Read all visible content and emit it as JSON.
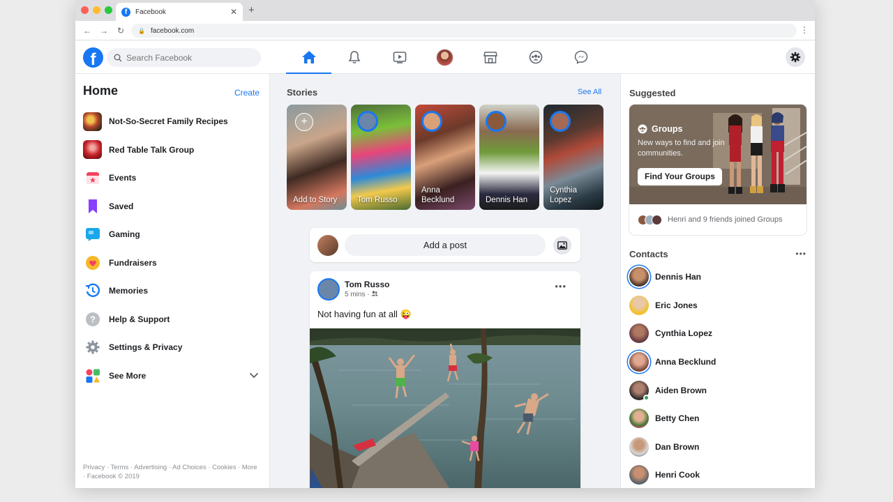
{
  "browser": {
    "tab_title": "Facebook",
    "tab_favicon": "f",
    "url": "facebook.com"
  },
  "header": {
    "logo": "f",
    "search_placeholder": "Search Facebook",
    "nav": [
      "home-icon",
      "bell-icon",
      "watch-icon",
      "profile-avatar",
      "marketplace-icon",
      "groups-icon",
      "messenger-icon"
    ],
    "active_nav": "home-icon",
    "accent": "#1877f2"
  },
  "left": {
    "title": "Home",
    "create": "Create",
    "items": [
      {
        "label": "Not-So-Secret Family Recipes",
        "icon": "group-photo-recipes"
      },
      {
        "label": "Red Table Talk Group",
        "icon": "group-photo-red-table"
      },
      {
        "label": "Events",
        "icon": "calendar-icon"
      },
      {
        "label": "Saved",
        "icon": "bookmark-icon"
      },
      {
        "label": "Gaming",
        "icon": "gaming-icon"
      },
      {
        "label": "Fundraisers",
        "icon": "heart-icon"
      },
      {
        "label": "Memories",
        "icon": "clock-icon"
      },
      {
        "label": "Help & Support",
        "icon": "question-icon"
      },
      {
        "label": "Settings & Privacy",
        "icon": "gear-icon"
      },
      {
        "label": "See More",
        "icon": "grid-icon"
      }
    ],
    "footer": "Privacy · Terms · Advertising · Ad Choices · Cookies · More · Facebook © 2019"
  },
  "stories": {
    "title": "Stories",
    "see_all": "See All",
    "items": [
      {
        "name": "Add to Story"
      },
      {
        "name": "Tom Russo"
      },
      {
        "name": "Anna Becklund"
      },
      {
        "name": "Dennis Han"
      },
      {
        "name": "Cynthia Lopez"
      }
    ]
  },
  "composer": {
    "placeholder": "Add a post"
  },
  "post": {
    "author": "Tom Russo",
    "time": "5 mins",
    "text": "Not having fun at all",
    "emoji": "😜"
  },
  "suggested": {
    "title": "Suggested",
    "card_title": "Groups",
    "card_desc": "New ways to find and join communities.",
    "button": "Find Your Groups",
    "footer": "Henri and 9 friends joined Groups"
  },
  "contacts": {
    "title": "Contacts",
    "items": [
      {
        "name": "Dennis Han",
        "story": true,
        "online": false
      },
      {
        "name": "Eric Jones",
        "story": false,
        "online": false
      },
      {
        "name": "Cynthia Lopez",
        "story": false,
        "online": false
      },
      {
        "name": "Anna Becklund",
        "story": true,
        "online": false
      },
      {
        "name": "Aiden Brown",
        "story": false,
        "online": true
      },
      {
        "name": "Betty Chen",
        "story": false,
        "online": false
      },
      {
        "name": "Dan Brown",
        "story": false,
        "online": false
      },
      {
        "name": "Henri Cook",
        "story": false,
        "online": false
      }
    ]
  }
}
